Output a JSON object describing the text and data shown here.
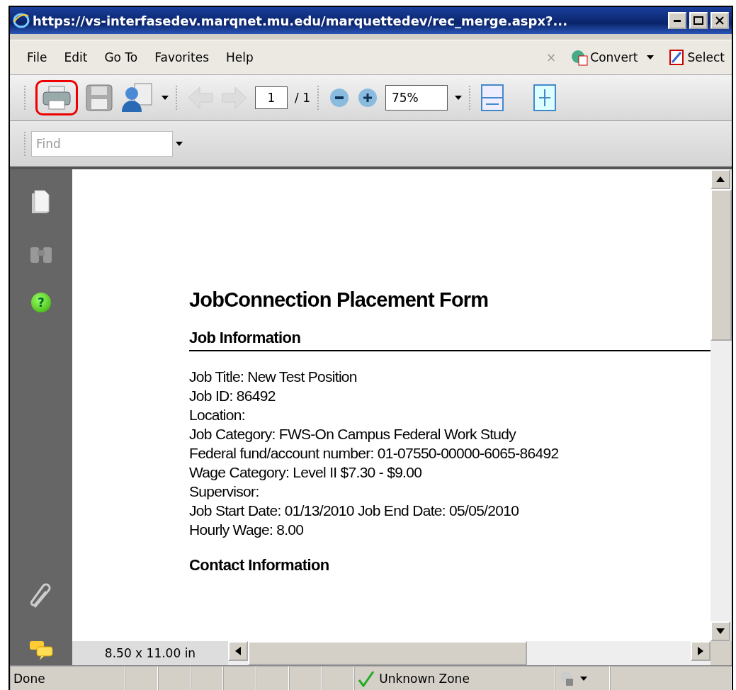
{
  "window": {
    "title": "https://vs-interfasedev.marqnet.mu.edu/marquettedev/rec_merge.aspx?..."
  },
  "menu": [
    "File",
    "Edit",
    "Go To",
    "Favorites",
    "Help"
  ],
  "menu_tools": [
    {
      "kind": "close",
      "label": "×",
      "disabled": true
    },
    {
      "kind": "convert",
      "label": "Convert"
    },
    {
      "kind": "select",
      "label": "Select"
    }
  ],
  "toolbar": {
    "print_highlighted": true,
    "page": "1",
    "page_total": "/ 1",
    "zoom": "75%"
  },
  "find": {
    "placeholder": "Find"
  },
  "sidebar": {
    "help_glyph": "?"
  },
  "document": {
    "title": "JobConnection Placement Form",
    "sections": [
      {
        "heading": "Job Information",
        "lines": [
          "Job Title:  New Test Position",
          "Job ID: 86492",
          "Location:",
          "Job Category:  FWS-On Campus Federal Work Study",
          "Federal fund/account number:  01-07550-00000-6065-86492",
          "Wage Category:  Level II $7.30 - $9.00",
          "Supervisor:",
          "Job Start Date: 01/13/2010 Job End Date: 05/05/2010",
          "Hourly Wage:  8.00"
        ]
      },
      {
        "heading": "Contact Information"
      }
    ]
  },
  "page_size": "8.50 x 11.00 in",
  "status_bar": {
    "text": "Done",
    "zone": "Unknown Zone"
  }
}
